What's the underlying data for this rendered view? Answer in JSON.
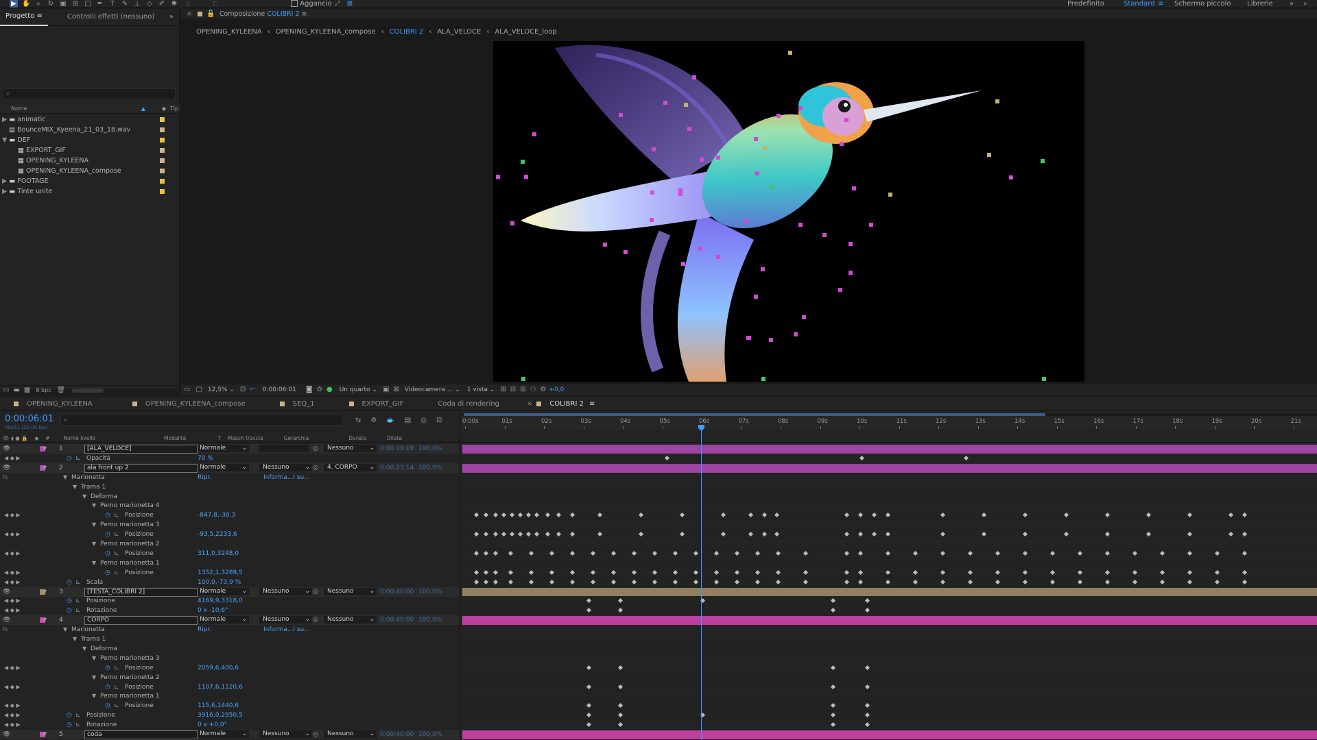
{
  "toolbar": {
    "snap_label": "Aggancio",
    "workspaces": [
      "Predefinito",
      "Standard",
      "Schermo piccolo",
      "Librerie"
    ]
  },
  "project_panel": {
    "tabs": [
      "Progetto",
      "Controlli effetti (nessuno)"
    ],
    "columns": {
      "name": "Nome",
      "type": "Tip"
    },
    "items": [
      {
        "name": "animatic",
        "kind": "folder",
        "color": "#e8c33a"
      },
      {
        "name": "BounceMIX_Kyeena_21_03_18.wav",
        "kind": "audio",
        "color": "#c9b48a"
      },
      {
        "name": "DEF",
        "kind": "folder-open",
        "color": "#e8c33a"
      },
      {
        "name": "EXPORT_GIF",
        "kind": "comp",
        "color": "#c9b48a"
      },
      {
        "name": "OPENING_KYLEENA",
        "kind": "comp",
        "color": "#c9b48a"
      },
      {
        "name": "OPENING_KYLEENA_compose",
        "kind": "comp",
        "color": "#c9b48a"
      },
      {
        "name": "FOOTAGE",
        "kind": "folder",
        "color": "#e8c33a"
      },
      {
        "name": "Tinte unite",
        "kind": "folder",
        "color": "#e8c33a"
      }
    ],
    "bpc": "8 bpc"
  },
  "viewer": {
    "title_prefix": "Composizione",
    "title_comp": "COLIBRI 2",
    "breadcrumbs": [
      "OPENING_KYLEENA",
      "OPENING_KYLEENA_compose",
      "COLIBRI 2",
      "ALA_VELOCE",
      "ALA_VELOCE_loop"
    ],
    "active_crumb": 2,
    "zoom": "12,5%",
    "timecode": "0:00:06:01",
    "resolution": "Un quarto",
    "camera": "Videocamera ...",
    "views": "1 vista",
    "exposure": "+0,0"
  },
  "timeline": {
    "tabs": [
      "OPENING_KYLEENA",
      "OPENING_KYLEENA_compose",
      "SEQ_1",
      "EXPORT_GIF",
      "Coda di rendering",
      "COLIBRI 2"
    ],
    "active_tab": 5,
    "current_time": "0:00:06:01",
    "fps_note": "00151 (25,00 fps)",
    "columns": [
      "#",
      "Nome livello",
      "Modalità",
      "T",
      "Masch traccia",
      "Gerarchia",
      "Durata",
      "Dilata"
    ],
    "ruler": [
      "0:00s",
      "01s",
      "02s",
      "03s",
      "04s",
      "05s",
      "06s",
      "07s",
      "08s",
      "09s",
      "10s",
      "11s",
      "12s",
      "13s",
      "14s",
      "15s",
      "16s",
      "17s",
      "18s",
      "19s",
      "20s",
      "21s"
    ],
    "rows": [
      {
        "kind": "layer",
        "num": "1",
        "name": "[ALA_VELOCE]",
        "mode": "Normale",
        "parent": "Nessuno",
        "duration": "0:00:19:19",
        "stretch": "100,0%",
        "color": "#b44ab8"
      },
      {
        "kind": "prop",
        "indent": 1,
        "name": "Opacità",
        "value": "70 %"
      },
      {
        "kind": "layer",
        "num": "2",
        "name": "ala front up 2",
        "mode": "Normale",
        "track": "Nessuno",
        "parent": "4. CORPO",
        "duration": "0:00:23:14",
        "stretch": "100,0%",
        "color": "#b44ab8"
      },
      {
        "kind": "group",
        "indent": 1,
        "name": "Marionetta",
        "value": "Ripr.",
        "extra": "Informa...i su..."
      },
      {
        "kind": "group",
        "indent": 2,
        "name": "Trama 1"
      },
      {
        "kind": "group",
        "indent": 3,
        "name": "Deforma"
      },
      {
        "kind": "group",
        "indent": 4,
        "name": "Perno marionetta 4"
      },
      {
        "kind": "prop",
        "indent": 5,
        "name": "Posizione",
        "value": "-847,8,-30,3"
      },
      {
        "kind": "group",
        "indent": 4,
        "name": "Perno marionetta 3"
      },
      {
        "kind": "prop",
        "indent": 5,
        "name": "Posizione",
        "value": "-93,5,2233,6"
      },
      {
        "kind": "group",
        "indent": 4,
        "name": "Perno marionetta 2"
      },
      {
        "kind": "prop",
        "indent": 5,
        "name": "Posizione",
        "value": "311,0,3248,0"
      },
      {
        "kind": "group",
        "indent": 4,
        "name": "Perno marionetta 1"
      },
      {
        "kind": "prop",
        "indent": 5,
        "name": "Posizione",
        "value": "1352,1,3289,5"
      },
      {
        "kind": "prop",
        "indent": 1,
        "name": "Scala",
        "value": "100,0,-73,9 %"
      },
      {
        "kind": "layer",
        "num": "3",
        "name": "[TESTA_COLIBRI 2]",
        "mode": "Normale",
        "track": "Nessuno",
        "parent": "Nessuno",
        "duration": "0:00:40:00",
        "stretch": "100,0%",
        "color": "#a68f68"
      },
      {
        "kind": "prop",
        "indent": 1,
        "name": "Posizione",
        "value": "4169,9,3318,0"
      },
      {
        "kind": "prop",
        "indent": 1,
        "name": "Rotazione",
        "value": "0 x -10,6°"
      },
      {
        "kind": "layer",
        "num": "4",
        "name": "CORPO",
        "mode": "Normale",
        "track": "Nessuno",
        "parent": "Nessuno",
        "duration": "0:00:40:00",
        "stretch": "100,0%",
        "color": "#d944b4"
      },
      {
        "kind": "group",
        "indent": 1,
        "name": "Marionetta",
        "value": "Ripr.",
        "extra": "Informa...i su..."
      },
      {
        "kind": "group",
        "indent": 2,
        "name": "Trama 1"
      },
      {
        "kind": "group",
        "indent": 3,
        "name": "Deforma"
      },
      {
        "kind": "group",
        "indent": 4,
        "name": "Perno marionetta 3"
      },
      {
        "kind": "prop",
        "indent": 5,
        "name": "Posizione",
        "value": "2059,6,400,6"
      },
      {
        "kind": "group",
        "indent": 4,
        "name": "Perno marionetta 2"
      },
      {
        "kind": "prop",
        "indent": 5,
        "name": "Posizione",
        "value": "1107,6,1120,6"
      },
      {
        "kind": "group",
        "indent": 4,
        "name": "Perno marionetta 1"
      },
      {
        "kind": "prop",
        "indent": 5,
        "name": "Posizione",
        "value": "115,6,1440,6"
      },
      {
        "kind": "prop",
        "indent": 1,
        "name": "Posizione",
        "value": "3916,0,2950,5"
      },
      {
        "kind": "prop",
        "indent": 1,
        "name": "Rotazione",
        "value": "0 x +0,0°"
      },
      {
        "kind": "layer",
        "num": "5",
        "name": "coda",
        "mode": "Normale",
        "track": "Nessuno",
        "parent": "Nessuno",
        "duration": "0:00:40:00",
        "stretch": "100,0%",
        "color": "#d944b4"
      }
    ]
  }
}
